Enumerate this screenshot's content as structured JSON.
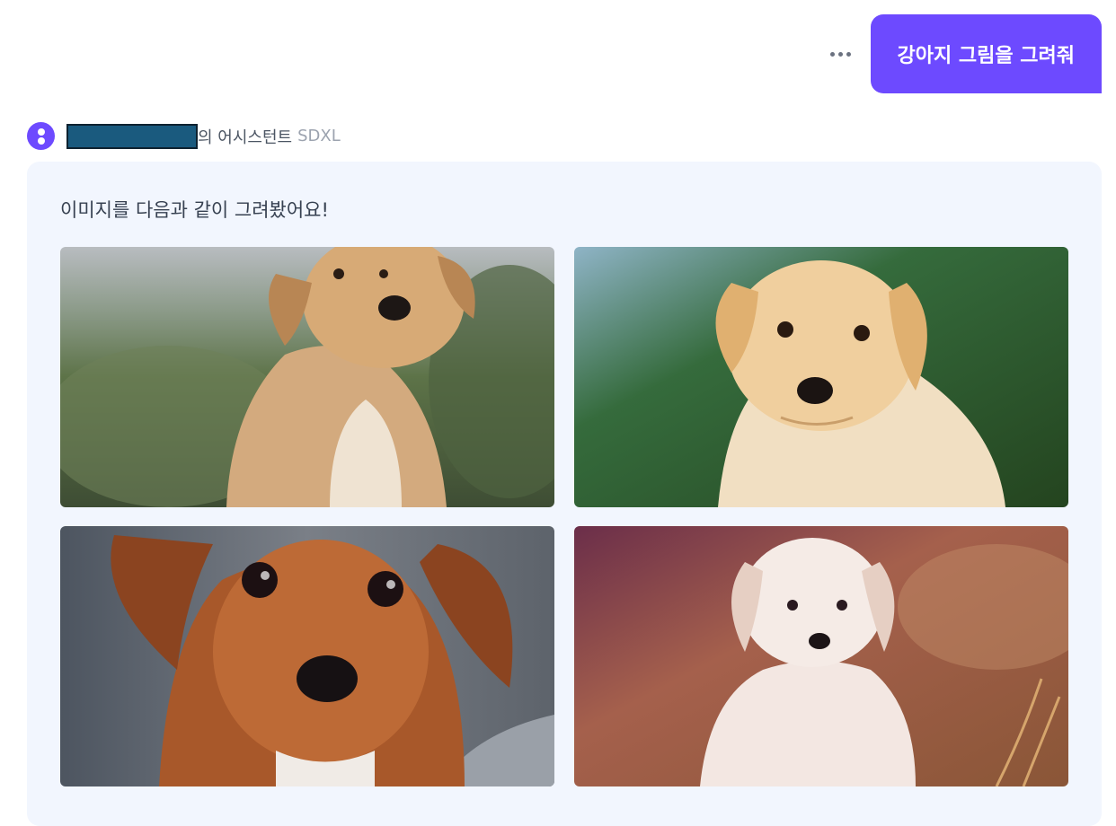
{
  "user_message": {
    "text": "강아지 그림을 그려줘"
  },
  "assistant": {
    "name_suffix": "의 어시스턴트",
    "model": "SDXL",
    "reply_text": "이미지를 다음과 같이 그려봤어요!"
  },
  "images": [
    {
      "label": "golden-retriever-puppy-blurred-grass"
    },
    {
      "label": "labrador-puppy-green-background"
    },
    {
      "label": "brown-puppy-closeup-gray-background"
    },
    {
      "label": "white-puppy-purple-field"
    }
  ],
  "colors": {
    "accent": "#6d4aff",
    "panel_bg": "#f2f6fe",
    "redaction": "#1a5a7e"
  }
}
